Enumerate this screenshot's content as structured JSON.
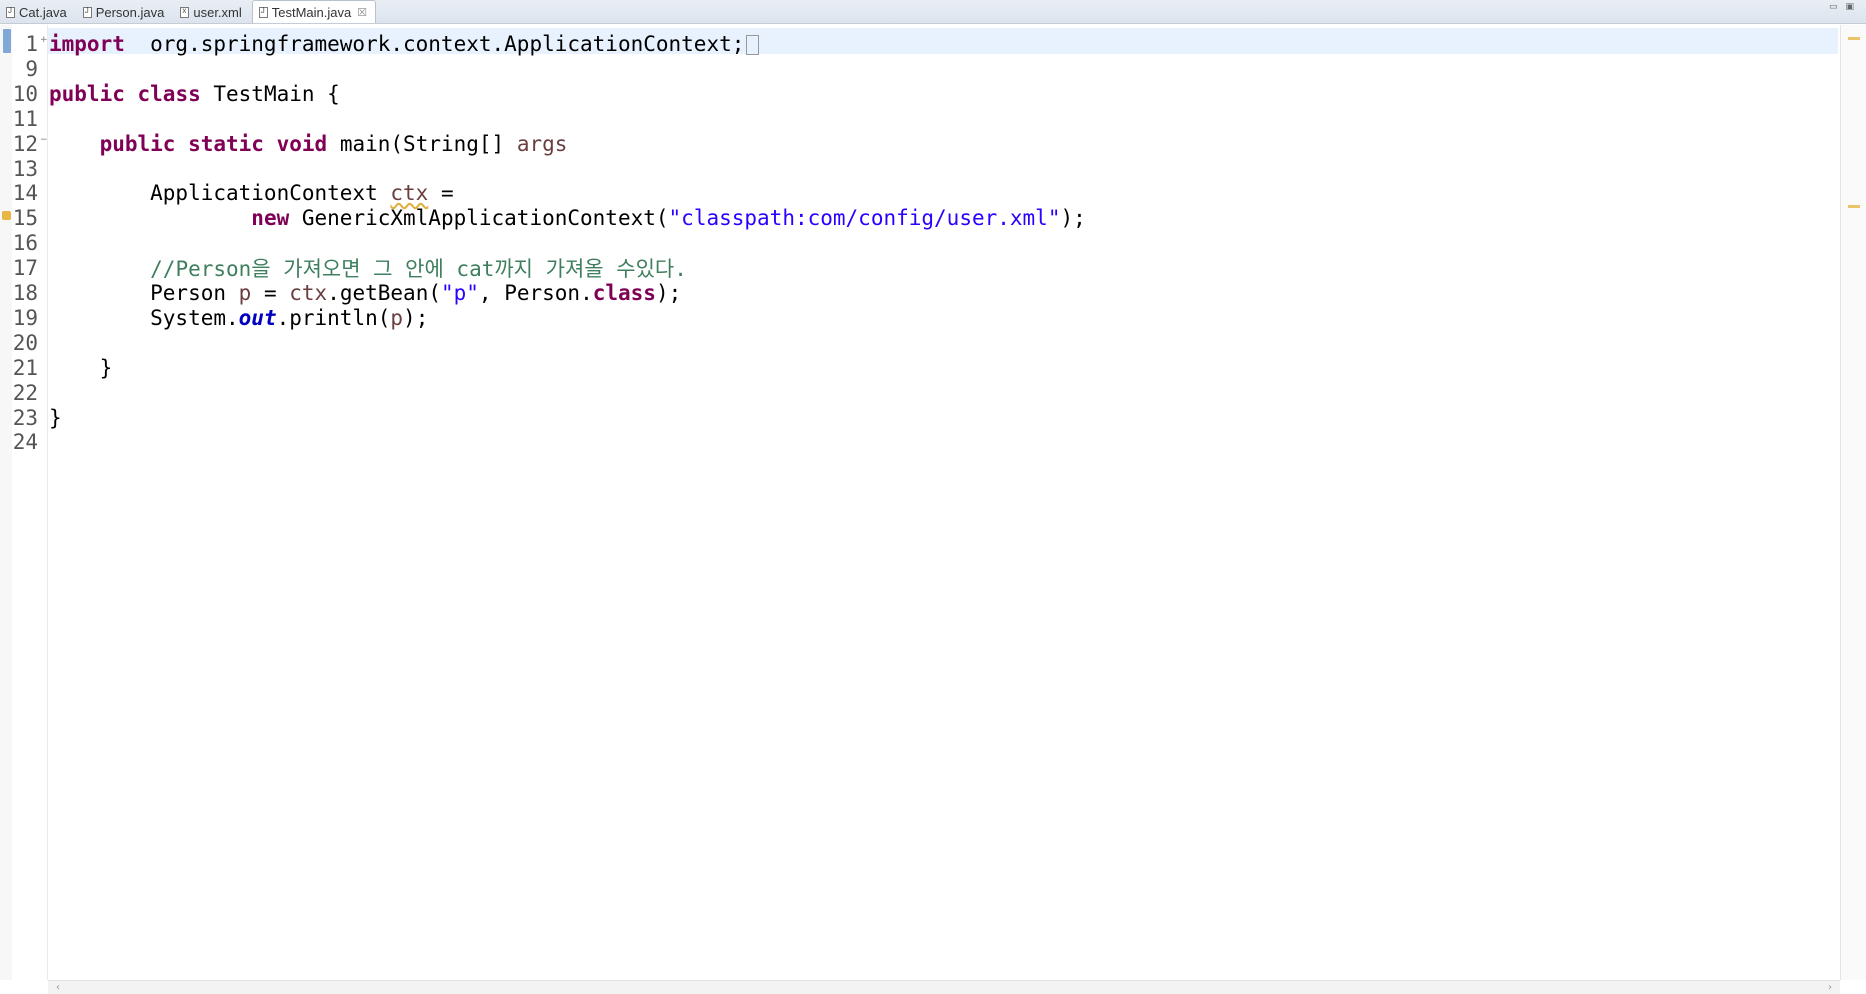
{
  "tabs": [
    {
      "label": "Cat.java",
      "icon": "java-file-icon",
      "active": false
    },
    {
      "label": "Person.java",
      "icon": "java-file-icon",
      "active": false
    },
    {
      "label": "user.xml",
      "icon": "xml-file-icon",
      "active": false
    },
    {
      "label": "TestMain.java",
      "icon": "java-file-icon",
      "active": true,
      "close": "☒"
    }
  ],
  "colors": {
    "keyword": "#7f0055",
    "string": "#2a00ff",
    "comment": "#3f7f5f",
    "variable": "#6a3e3e",
    "field": "#0000c0",
    "current_line": "#e8f2fe"
  },
  "lines": [
    {
      "num": "1",
      "fold": "+",
      "tokens": [
        [
          "kw",
          "import"
        ],
        [
          "",
          "  org.springframework.context.ApplicationContext;"
        ]
      ],
      "folded_box": true
    },
    {
      "num": "9",
      "tokens": []
    },
    {
      "num": "10",
      "tokens": [
        [
          "kw",
          "public"
        ],
        [
          "",
          " "
        ],
        [
          "kw",
          "class"
        ],
        [
          "",
          " TestMain {"
        ]
      ]
    },
    {
      "num": "11",
      "tokens": []
    },
    {
      "num": "12",
      "fold": "−",
      "tokens": [
        [
          "",
          "    "
        ],
        [
          "kw",
          "public"
        ],
        [
          "",
          " "
        ],
        [
          "kw",
          "static"
        ],
        [
          "",
          " "
        ],
        [
          "kw",
          "void"
        ],
        [
          "",
          " main(String[] "
        ],
        [
          "var",
          "args"
        ],
        [
          ") {"
        ]
      ]
    },
    {
      "num": "13",
      "tokens": []
    },
    {
      "num": "14",
      "tokens": [
        [
          "",
          "        ApplicationContext "
        ],
        [
          "var warnvar",
          "ctx"
        ],
        [
          "",
          " ="
        ]
      ]
    },
    {
      "num": "15",
      "tokens": [
        [
          "",
          "                "
        ],
        [
          "kw",
          "new"
        ],
        [
          "",
          " GenericXmlApplicationContext("
        ],
        [
          "str",
          "\"classpath:com/config/user.xml\""
        ],
        [
          "",
          ");"
        ]
      ]
    },
    {
      "num": "16",
      "tokens": []
    },
    {
      "num": "17",
      "tokens": [
        [
          "",
          "        "
        ],
        [
          "cm",
          "//Person을 가져오면 그 안에 cat까지 가져올 수있다."
        ]
      ]
    },
    {
      "num": "18",
      "tokens": [
        [
          "",
          "        Person "
        ],
        [
          "var",
          "p"
        ],
        [
          "",
          " = "
        ],
        [
          "var",
          "ctx"
        ],
        [
          "",
          ".getBean("
        ],
        [
          "str",
          "\"p\""
        ],
        [
          "",
          ", Person."
        ],
        [
          "kw",
          "class"
        ],
        [
          "",
          ");"
        ]
      ]
    },
    {
      "num": "19",
      "tokens": [
        [
          "",
          "        System."
        ],
        [
          "fld",
          "out"
        ],
        [
          "",
          ".println("
        ],
        [
          "var",
          "p"
        ],
        [
          "",
          ");"
        ]
      ]
    },
    {
      "num": "20",
      "tokens": []
    },
    {
      "num": "21",
      "tokens": [
        [
          "",
          "    }"
        ]
      ]
    },
    {
      "num": "22",
      "tokens": []
    },
    {
      "num": "23",
      "tokens": [
        [
          "",
          "}"
        ]
      ]
    },
    {
      "num": "24",
      "tokens": []
    }
  ]
}
